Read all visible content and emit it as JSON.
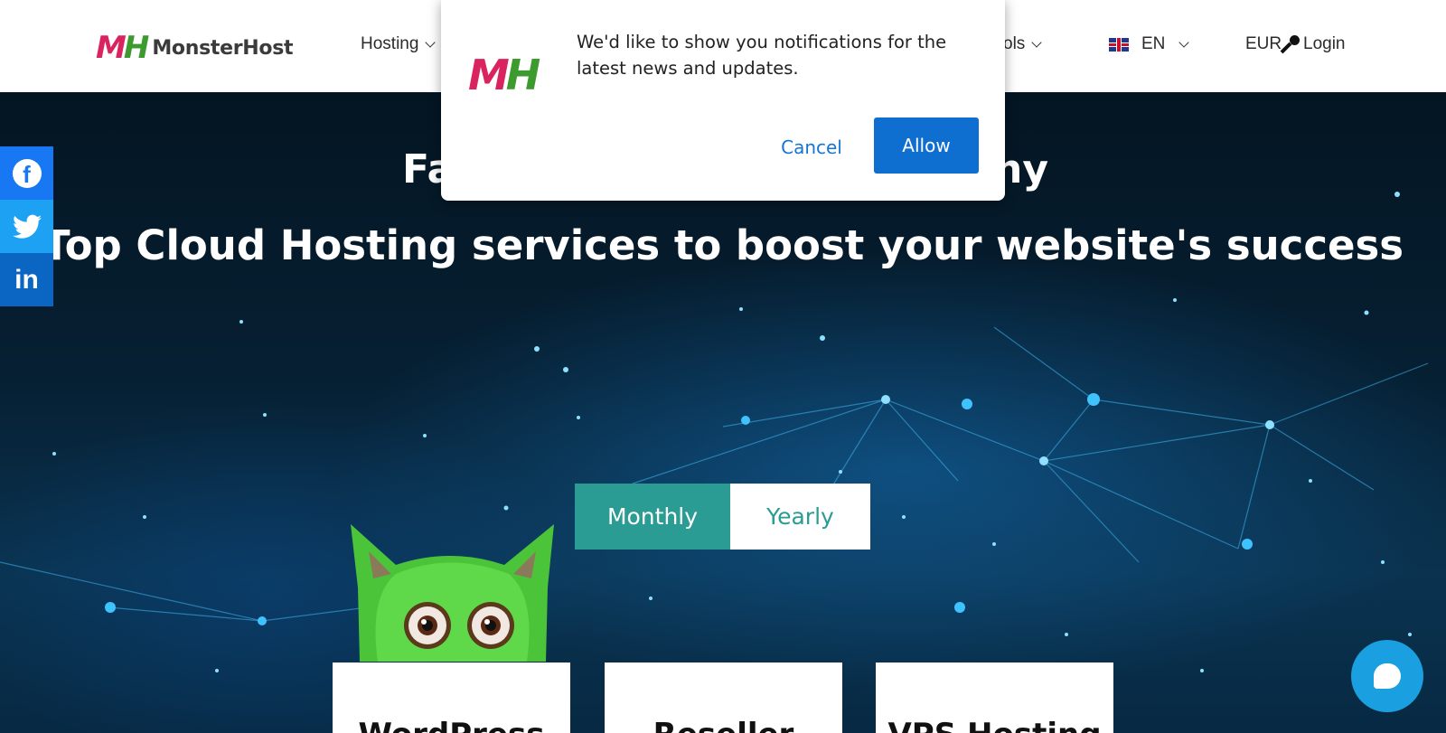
{
  "brand": {
    "name": "MonsterHost",
    "mark_m": "M",
    "mark_h": "H"
  },
  "nav": {
    "hosting": "Hosting",
    "tools": "ols",
    "lang": "EN",
    "currency": "EUR",
    "login": "Login"
  },
  "hero": {
    "title_left": "Fa",
    "title_right": "ny",
    "subtitle": "Top Cloud Hosting services to boost your website's success"
  },
  "billing_toggle": {
    "monthly": "Monthly",
    "yearly": "Yearly",
    "selected": "Monthly"
  },
  "plans": [
    {
      "name": "WordPress"
    },
    {
      "name": "Reseller"
    },
    {
      "name": "VPS Hosting"
    }
  ],
  "social": [
    "facebook",
    "twitter",
    "linkedin"
  ],
  "notification": {
    "message": "We'd like to show you notifications for the latest news and updates.",
    "cancel": "Cancel",
    "allow": "Allow"
  },
  "colors": {
    "accent_teal": "#2b9c93",
    "allow_blue": "#0e6fd1",
    "chat_blue": "#1a9fe0",
    "facebook": "#1877f2",
    "twitter": "#1da1f2",
    "linkedin": "#0a66c2"
  }
}
